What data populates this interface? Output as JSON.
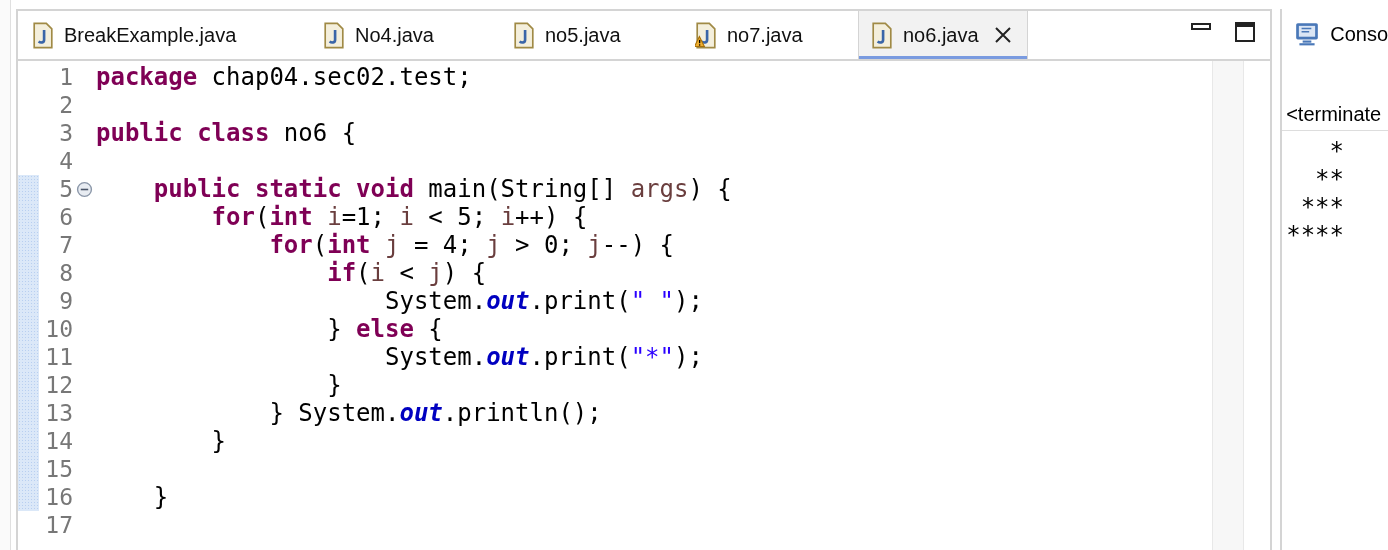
{
  "editor": {
    "tabs": [
      {
        "label": "BreakExample.java",
        "selected": false,
        "warning": false
      },
      {
        "label": "No4.java",
        "selected": false,
        "warning": false
      },
      {
        "label": "no5.java",
        "selected": false,
        "warning": false
      },
      {
        "label": "no7.java",
        "selected": false,
        "warning": true
      },
      {
        "label": "no6.java",
        "selected": true,
        "warning": false
      }
    ],
    "lines": [
      {
        "number": "1",
        "highlighted": false,
        "tokens": [
          {
            "kind": "keyword",
            "text": "package"
          },
          {
            "kind": "plain",
            "text": " chap04.sec02.test;"
          }
        ]
      },
      {
        "number": "2",
        "highlighted": false
      },
      {
        "number": "3",
        "highlighted": false,
        "tokens": [
          {
            "kind": "keyword",
            "text": "public"
          },
          {
            "kind": "keyword",
            "text": " class"
          },
          {
            "kind": "plain",
            "text": " no6 {"
          }
        ]
      },
      {
        "number": "4",
        "highlighted": false
      },
      {
        "number": "5",
        "highlighted": true,
        "expanded": true,
        "tokens": [
          {
            "kind": "keyword",
            "text": "    public"
          },
          {
            "kind": "keyword",
            "text": " static"
          },
          {
            "kind": "keyword",
            "text": " void"
          },
          {
            "kind": "plain",
            "text": " main(String[] "
          },
          {
            "kind": "local",
            "text": "args"
          },
          {
            "kind": "plain",
            "text": ") {"
          }
        ]
      },
      {
        "number": "6",
        "highlighted": true,
        "tokens": [
          {
            "kind": "keyword",
            "text": "        for"
          },
          {
            "kind": "plain",
            "text": "("
          },
          {
            "kind": "keyword",
            "text": "int"
          },
          {
            "kind": "local",
            "text": " i"
          },
          {
            "kind": "plain",
            "text": "=1; "
          },
          {
            "kind": "local",
            "text": "i"
          },
          {
            "kind": "plain",
            "text": " < 5; "
          },
          {
            "kind": "local",
            "text": "i"
          },
          {
            "kind": "plain",
            "text": "++) {"
          }
        ]
      },
      {
        "number": "7",
        "highlighted": true,
        "tokens": [
          {
            "kind": "keyword",
            "text": "            for"
          },
          {
            "kind": "plain",
            "text": "("
          },
          {
            "kind": "keyword",
            "text": "int"
          },
          {
            "kind": "local",
            "text": " j"
          },
          {
            "kind": "plain",
            "text": " = 4; "
          },
          {
            "kind": "local",
            "text": "j"
          },
          {
            "kind": "plain",
            "text": " > 0; "
          },
          {
            "kind": "local",
            "text": "j"
          },
          {
            "kind": "plain",
            "text": "--) {"
          }
        ]
      },
      {
        "number": "8",
        "highlighted": true,
        "tokens": [
          {
            "kind": "keyword",
            "text": "                if"
          },
          {
            "kind": "plain",
            "text": "("
          },
          {
            "kind": "local",
            "text": "i"
          },
          {
            "kind": "plain",
            "text": " < "
          },
          {
            "kind": "local",
            "text": "j"
          },
          {
            "kind": "plain",
            "text": ") {"
          }
        ]
      },
      {
        "number": "9",
        "highlighted": true,
        "tokens": [
          {
            "kind": "plain",
            "text": "                    System."
          },
          {
            "kind": "field",
            "text": "out"
          },
          {
            "kind": "plain",
            "text": ".print("
          },
          {
            "kind": "string",
            "text": "\" \""
          },
          {
            "kind": "plain",
            "text": ");"
          }
        ]
      },
      {
        "number": "10",
        "highlighted": true,
        "tokens": [
          {
            "kind": "plain",
            "text": "                } "
          },
          {
            "kind": "keyword",
            "text": "else"
          },
          {
            "kind": "plain",
            "text": " {"
          }
        ]
      },
      {
        "number": "11",
        "highlighted": true,
        "tokens": [
          {
            "kind": "plain",
            "text": "                    System."
          },
          {
            "kind": "field",
            "text": "out"
          },
          {
            "kind": "plain",
            "text": ".print("
          },
          {
            "kind": "string",
            "text": "\"*\""
          },
          {
            "kind": "plain",
            "text": ");"
          }
        ]
      },
      {
        "number": "12",
        "highlighted": true,
        "tokens": [
          {
            "kind": "plain",
            "text": "                }"
          }
        ]
      },
      {
        "number": "13",
        "highlighted": true,
        "tokens": [
          {
            "kind": "plain",
            "text": "            } System."
          },
          {
            "kind": "field",
            "text": "out"
          },
          {
            "kind": "plain",
            "text": ".println();"
          }
        ]
      },
      {
        "number": "14",
        "highlighted": true,
        "tokens": [
          {
            "kind": "plain",
            "text": "        }"
          }
        ]
      },
      {
        "number": "15",
        "highlighted": true
      },
      {
        "number": "16",
        "highlighted": true,
        "tokens": [
          {
            "kind": "plain",
            "text": "    }"
          }
        ]
      },
      {
        "number": "17",
        "highlighted": false
      }
    ]
  },
  "console": {
    "tab": "Conso",
    "status": "<terminate",
    "output": [
      "   *",
      "  **",
      " ***",
      "****"
    ]
  }
}
